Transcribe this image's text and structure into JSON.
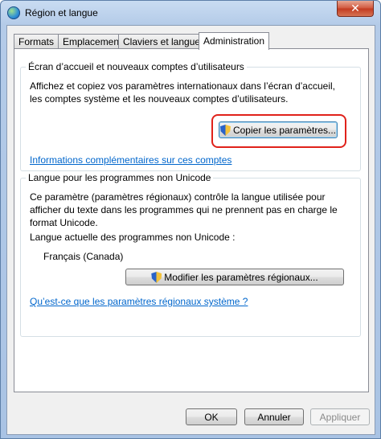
{
  "window": {
    "title": "Région et langue",
    "close_label": "✕"
  },
  "tabs": [
    {
      "label": "Formats"
    },
    {
      "label": "Emplacement"
    },
    {
      "label": "Claviers et langues"
    },
    {
      "label": "Administration"
    }
  ],
  "welcome_group": {
    "label": "Écran d’accueil et nouveaux comptes d’utilisateurs",
    "description_line1": "Affichez et copiez vos paramètres internationaux dans l’écran d’accueil,",
    "description_line2": "les comptes système et les nouveaux comptes d’utilisateurs.",
    "copy_button": "Copier les paramètres...",
    "link": "Informations complémentaires sur ces comptes"
  },
  "unicode_group": {
    "label": "Langue pour les programmes non Unicode",
    "description_line1": "Ce paramètre (paramètres régionaux) contrôle la langue utilisée pour",
    "description_line2": "afficher du texte dans les programmes qui ne prennent pas en charge le",
    "description_line3": "format Unicode.",
    "current_label": "Langue actuelle des programmes non Unicode :",
    "current_value": "Français (Canada)",
    "change_button": "Modifier les paramètres régionaux...",
    "link": "Qu’est-ce que les paramètres régionaux système ?"
  },
  "dialog_buttons": {
    "ok": "OK",
    "cancel": "Annuler",
    "apply": "Appliquer"
  },
  "colors": {
    "highlight": "#e0221b",
    "link": "#0066cc"
  },
  "icons": {
    "window": "globe-icon",
    "shield": "uac-shield-icon"
  }
}
